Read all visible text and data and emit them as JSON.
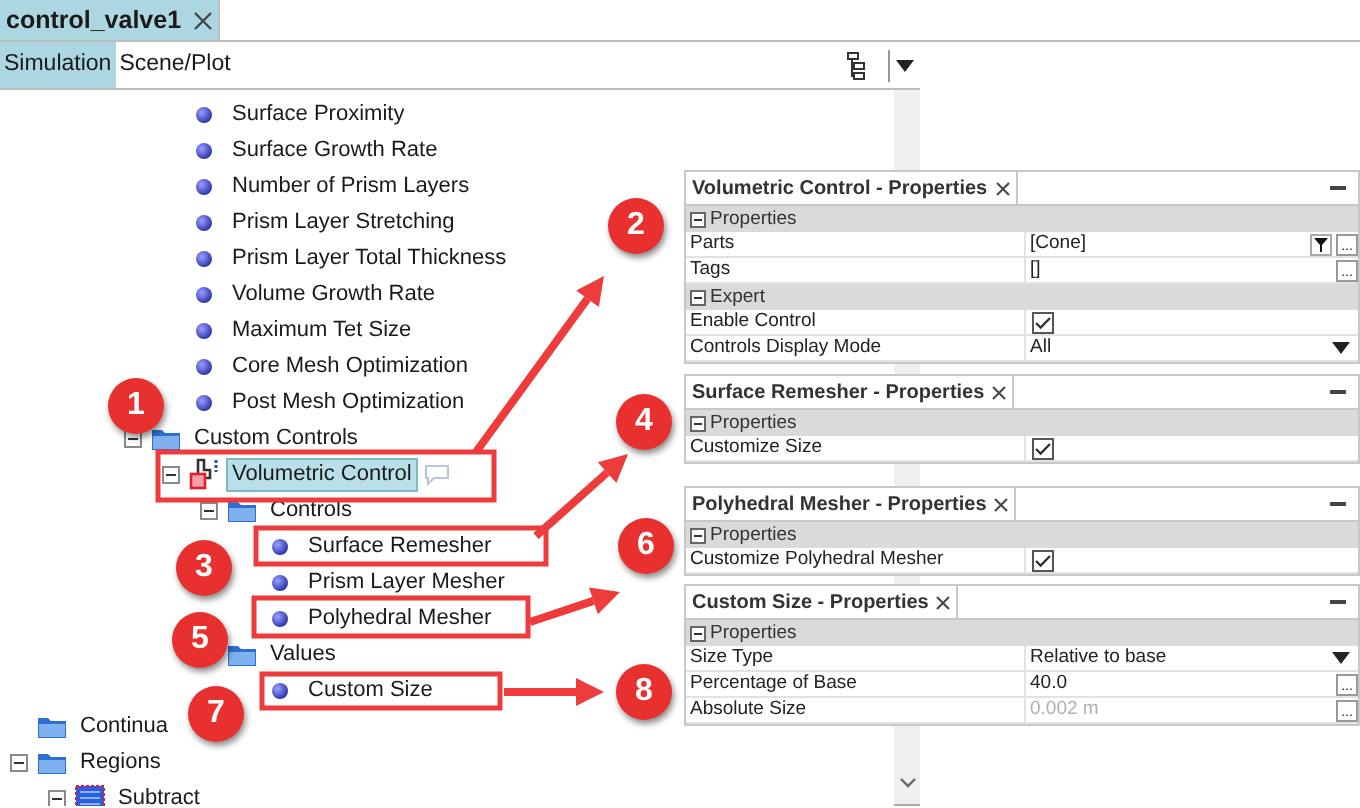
{
  "document_tab": {
    "title": "control_valve1",
    "selected": true
  },
  "view_tabs": [
    {
      "label": "Simulation",
      "selected": true
    },
    {
      "label": "Scene/Plot",
      "selected": false
    }
  ],
  "tree": [
    {
      "children": [
        {
          "children": [
            {
              "children": [
                {
                  "children": [
                    {
                      "label": "Surface Proximity",
                      "kind": "value",
                      "selected": false
                    },
                    {
                      "label": "Surface Growth Rate",
                      "kind": "value",
                      "selected": false
                    },
                    {
                      "label": "Number of Prism Layers",
                      "kind": "value",
                      "selected": false
                    },
                    {
                      "label": "Prism Layer Stretching",
                      "kind": "value",
                      "selected": false
                    },
                    {
                      "label": "Prism Layer Total Thickness",
                      "kind": "value",
                      "selected": false
                    },
                    {
                      "label": "Volume Growth Rate",
                      "kind": "value",
                      "selected": false
                    },
                    {
                      "label": "Maximum Tet Size",
                      "kind": "value",
                      "selected": false
                    },
                    {
                      "label": "Core Mesh Optimization",
                      "kind": "value",
                      "selected": false
                    },
                    {
                      "label": "Post Mesh Optimization",
                      "kind": "value",
                      "selected": false
                    }
                  ]
                },
                {
                  "label": "Custom Controls",
                  "kind": "folder",
                  "expanded": true,
                  "selected": false,
                  "children": [
                    {
                      "label": "Volumetric Control",
                      "kind": "control",
                      "expanded": true,
                      "selected": true,
                      "children": [
                        {
                          "label": "Controls",
                          "kind": "folder",
                          "expanded": true,
                          "selected": false,
                          "children": [
                            {
                              "label": "Surface Remesher",
                              "kind": "value",
                              "selected": false
                            },
                            {
                              "label": "Prism Layer Mesher",
                              "kind": "value",
                              "selected": false
                            },
                            {
                              "label": "Polyhedral Mesher",
                              "kind": "value",
                              "selected": false
                            }
                          ]
                        },
                        {
                          "label": "Values",
                          "kind": "folder",
                          "selected": false,
                          "children": [
                            {
                              "label": "Custom Size",
                              "kind": "value",
                              "selected": false
                            }
                          ]
                        }
                      ]
                    }
                  ]
                }
              ]
            }
          ]
        }
      ]
    },
    {
      "label": "Continua",
      "kind": "folder",
      "selected": false
    },
    {
      "label": "Regions",
      "kind": "folder",
      "expanded": true,
      "selected": false,
      "children": [
        {
          "label": "Subtract",
          "kind": "part",
          "expanded": true,
          "selected": false
        }
      ]
    }
  ],
  "property_panels": [
    {
      "title": "Volumetric Control - Properties",
      "rows": [
        {
          "kind": "group",
          "label": "Properties"
        },
        {
          "kind": "text",
          "name": "Parts",
          "value": "[Cone]",
          "filter": true,
          "button": "..."
        },
        {
          "kind": "text",
          "name": "Tags",
          "value": "[]",
          "button": "..."
        },
        {
          "kind": "group",
          "label": "Expert"
        },
        {
          "kind": "check",
          "name": "Enable Control",
          "checked": true
        },
        {
          "kind": "select",
          "name": "Controls Display Mode",
          "value": "All"
        }
      ]
    },
    {
      "title": "Surface Remesher - Properties",
      "rows": [
        {
          "kind": "group",
          "label": "Properties"
        },
        {
          "kind": "check",
          "name": "Customize Size",
          "checked": true
        }
      ]
    },
    {
      "title": "Polyhedral Mesher - Properties",
      "rows": [
        {
          "kind": "group",
          "label": "Properties"
        },
        {
          "kind": "check",
          "name": "Customize Polyhedral Mesher",
          "checked": true
        }
      ]
    },
    {
      "title": "Custom Size - Properties",
      "rows": [
        {
          "kind": "group",
          "label": "Properties"
        },
        {
          "kind": "select",
          "name": "Size Type",
          "value": "Relative to base"
        },
        {
          "kind": "text",
          "name": "Percentage of Base",
          "value": "40.0",
          "button": "..."
        },
        {
          "kind": "text",
          "name": "Absolute Size",
          "value": "0.002 m",
          "disabled": true,
          "button": "..."
        }
      ]
    }
  ],
  "callouts": [
    {
      "number": "1"
    },
    {
      "number": "2"
    },
    {
      "number": "3"
    },
    {
      "number": "4"
    },
    {
      "number": "5"
    },
    {
      "number": "6"
    },
    {
      "number": "7"
    },
    {
      "number": "8"
    }
  ]
}
